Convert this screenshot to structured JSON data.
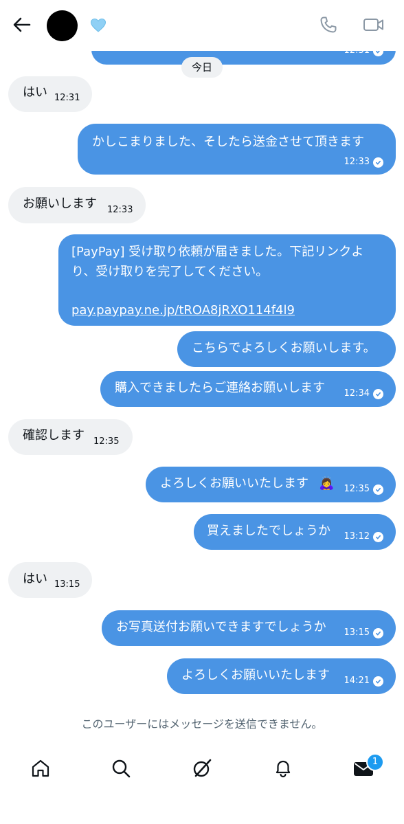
{
  "header": {
    "back_icon": "arrow-left-icon",
    "avatar": "avatar",
    "badge_icon": "light-blue-heart-icon",
    "call_icon": "phone-icon",
    "video_icon": "video-camera-icon"
  },
  "top_partial_message": {
    "time": "12:31"
  },
  "date_separator": "今日",
  "messages": [
    {
      "dir": "in",
      "text": "はい",
      "time": "12:31"
    },
    {
      "dir": "out",
      "text": "かしこまりました、そしたら送金させて頂きます",
      "time": "12:33"
    },
    {
      "dir": "in",
      "text": "お願いします",
      "time": "12:33"
    },
    {
      "dir": "out",
      "lines": [
        "[PayPay] 受け取り依頼が届きました。下記リンクよ",
        "り、受け取りを完了してください。"
      ],
      "link": "pay.paypay.ne.jp/tROA8jRXO114f4l9"
    },
    {
      "dir": "out",
      "text": "こちらでよろしくお願いします。"
    },
    {
      "dir": "out",
      "text": "購入できましたらご連絡お願いします",
      "time": "12:34"
    },
    {
      "dir": "in",
      "text": "確認します",
      "time": "12:35"
    },
    {
      "dir": "out",
      "text": "よろしくお願いいたします",
      "emoji": "🙇‍♀️",
      "time": "12:35"
    },
    {
      "dir": "out",
      "text": "買えましたでしょうか",
      "time": "13:12"
    },
    {
      "dir": "in",
      "text": "はい",
      "time": "13:15"
    },
    {
      "dir": "out",
      "text": "お写真送付お願いできますでしょうか",
      "time": "13:15"
    },
    {
      "dir": "out",
      "text": "よろしくお願いいたします",
      "time": "14:21"
    }
  ],
  "footer_note": "このユーザーにはメッセージを送信できません。",
  "bottom_nav": {
    "items": [
      "home-icon",
      "search-icon",
      "grok-icon",
      "notifications-bell-icon",
      "messages-envelope-icon"
    ],
    "messages_badge": "1"
  },
  "colors": {
    "outgoing_bubble": "#4a94e4",
    "incoming_bubble": "#eff1f3",
    "badge": "#1d9bf0"
  }
}
